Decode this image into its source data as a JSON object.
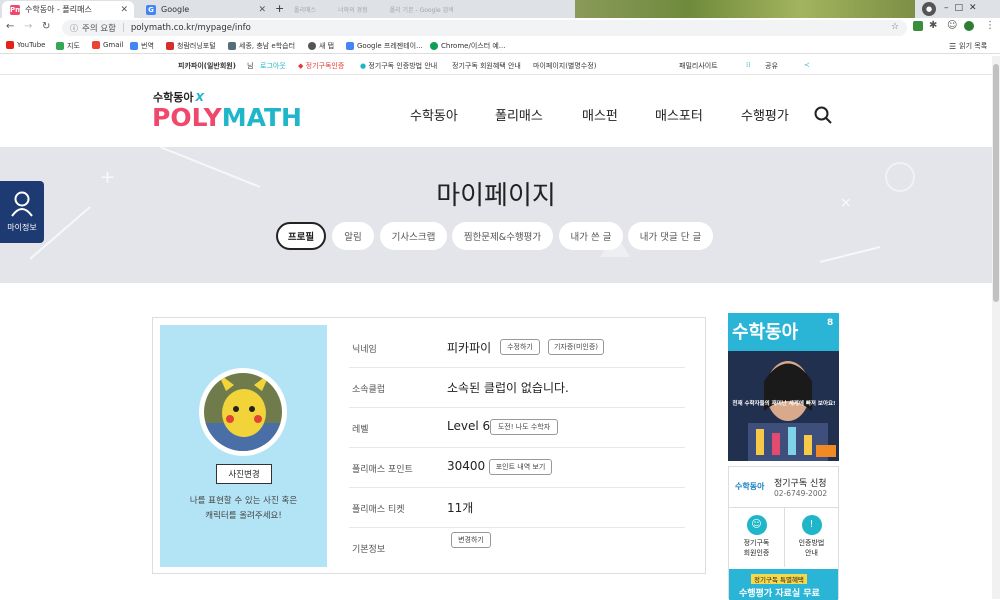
{
  "browser": {
    "tabs": [
      {
        "title": "수학동아 - 폴리매스",
        "fav": "Pm"
      },
      {
        "title": "Google",
        "fav": "G"
      }
    ],
    "faded_tabs": [
      "폴리매스",
      "너와의 경험",
      "폴리 기본 - Google 검색",
      "마이페이지"
    ],
    "security": "주의 요함",
    "url": "polymath.co.kr/mypage/info",
    "bookmarks": [
      "YouTube",
      "지도",
      "Gmail",
      "번역",
      "청람러닝포털",
      "세종, 충남 e학습터",
      "새 탭",
      "Google 프레젠테이...",
      "Chrome/이스터 예..."
    ],
    "reading_list": "읽기 목록"
  },
  "site_top": {
    "user": "피카파이(일반회원)",
    "user_suffix": "님",
    "logout": "로그아웃",
    "subscribe_cert": "정기구독인증",
    "cert_guide": "정기구독 인증방법 안내",
    "benefit": "정기구독 회원혜택 안내",
    "mypage": "마이페이지(별명수정)",
    "family": "패밀리사이트",
    "share": "공유"
  },
  "header": {
    "logo_top": "수학동아",
    "logo_x": "X",
    "logo_main": "POLYMATH",
    "nav": [
      "수학동아",
      "폴리매스",
      "매스펀",
      "매스포터",
      "수행평가"
    ]
  },
  "hero": {
    "title": "마이페이지",
    "tabs": [
      "프로필",
      "알림",
      "기사스크랩",
      "찜한문제&수행평가",
      "내가 쓴 글",
      "내가 댓글 단 글"
    ]
  },
  "side_button": {
    "label": "마이정보"
  },
  "profile": {
    "photo_button": "사진변경",
    "photo_hint_1": "나를 표현할 수 있는 사진 혹은",
    "photo_hint_2": "캐릭터를 올려주세요!",
    "rows": [
      {
        "label": "닉네임",
        "value": "피카파이",
        "buttons": [
          "수정하기",
          "기자증(미인증)"
        ]
      },
      {
        "label": "소속클럽",
        "value": "소속된 클럽이 없습니다.",
        "buttons": []
      },
      {
        "label": "레벨",
        "value": "Level 6",
        "buttons": [
          "도전! 나도 수학자"
        ]
      },
      {
        "label": "폴리매스 포인트",
        "value": "30400",
        "buttons": [
          "포인트 내역 보기"
        ]
      },
      {
        "label": "폴리매스 티켓",
        "value": "11개",
        "buttons": []
      },
      {
        "label": "기본정보",
        "value": "",
        "buttons": [
          "변경하기"
        ]
      }
    ]
  },
  "ads": {
    "mag_title": "수학동아",
    "mag_issue": "8",
    "mag_line": "천재 수학자들의 재미난 세계에 빠져 보아요!",
    "subs_title": "정기구독 신청",
    "subs_phone": "02-6749-2002",
    "subs_logo": "수학동아",
    "btn_a_1": "정기구독",
    "btn_a_2": "회원인증",
    "btn_b_1": "인증방법",
    "btn_b_2": "안내",
    "promo_1": "정기구독 특별혜택",
    "promo_2": "수행평가 자료실 무료"
  },
  "colors": {
    "accent_pink": "#f0476c",
    "accent_teal": "#1eb6c8",
    "sidebar_blue": "#1d3a72",
    "panel_sky": "#b3e4f5"
  }
}
